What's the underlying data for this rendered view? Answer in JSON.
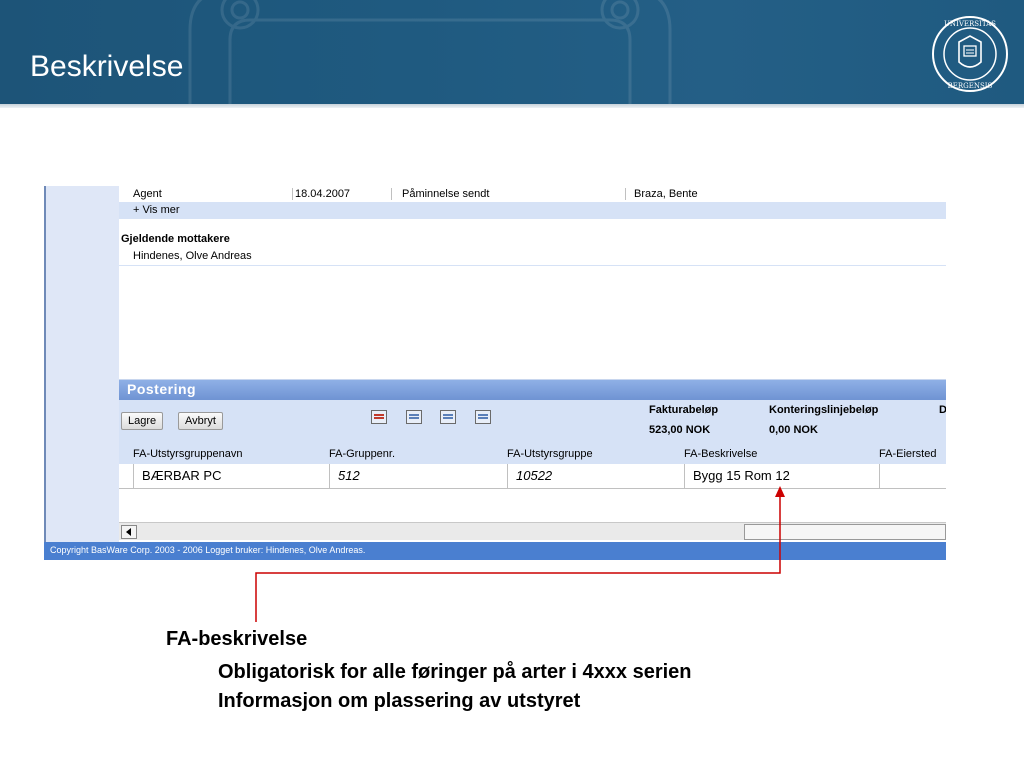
{
  "slide": {
    "title": "Beskrivelse"
  },
  "app": {
    "history_row": {
      "col1": "Agent",
      "col2": "18.04.2007",
      "col3": "Påminnelse sendt",
      "col4": "Braza, Bente"
    },
    "vis_mer": "+ Vis mer",
    "recipients_title": "Gjeldende mottakere",
    "recipient": "Hindenes, Olve Andreas",
    "section_title": "Postering",
    "buttons": {
      "save": "Lagre",
      "cancel": "Avbryt"
    },
    "toolbar_icons": [
      "delete-row-icon",
      "add-row-icon",
      "edit-row-icon",
      "copy-row-icon"
    ],
    "summary": {
      "invoice_label": "Fakturabeløp",
      "invoice_value": "523,00 NOK",
      "line_label": "Konteringslinjebeløp",
      "line_value": "0,00 NOK",
      "extra_label": "D"
    },
    "columns": [
      "FA-Utstyrsgruppenavn",
      "FA-Gruppenr.",
      "FA-Utstyrsgruppe",
      "FA-Beskrivelse",
      "FA-Eiersted"
    ],
    "row": {
      "group_name": "BÆRBAR PC",
      "group_no": "512",
      "equipment_group": "10522",
      "description": "Bygg 15 Rom 12",
      "owner": ""
    },
    "footer": "Copyright BasWare Corp. 2003 - 2006  Logget bruker: Hindenes, Olve Andreas."
  },
  "annotation": {
    "title": "FA-beskrivelse",
    "line1": "Obligatorisk for alle føringer på arter i 4xxx serien",
    "line2": "Informasjon om plassering av utstyret"
  },
  "colors": {
    "header_bg": "#1f5a80",
    "grid_band": "#d6e2f6",
    "section_bar": "#7fa3de",
    "footer_bar": "#4a7fd0",
    "callout_line": "#cc0000"
  }
}
